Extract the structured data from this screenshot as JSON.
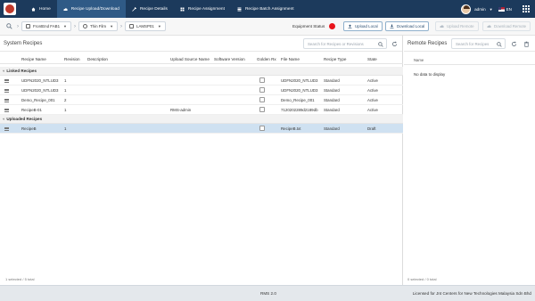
{
  "topbar": {
    "tabs": [
      {
        "label": "Home",
        "icon": "home-icon"
      },
      {
        "label": "Recipe Upload/Download",
        "icon": "cloud-icon"
      },
      {
        "label": "Recipe Details",
        "icon": "tools-icon"
      },
      {
        "label": "Recipe Assignment",
        "icon": "assign-icon"
      },
      {
        "label": "Recipe Batch Assignment",
        "icon": "batch-icon"
      }
    ],
    "active_tab": "Recipe Upload/Download",
    "user": "admin",
    "language": "EN"
  },
  "toolbar": {
    "breadcrumbs": [
      {
        "label": "FrontEnd FAB1"
      },
      {
        "label": "Thin Film"
      },
      {
        "label": "LAMSP01"
      }
    ],
    "equipment_status_label": "Equipment Status",
    "equipment_status_color": "#e8141b",
    "buttons": {
      "upload_local": "Upload Local",
      "download_local": "Download Local",
      "upload_remote": "Upload Remote",
      "download_remote": "Download Remote"
    }
  },
  "system_recipes": {
    "title": "System Recipes",
    "search_placeholder": "Search for Recipes or Revisions",
    "columns": {
      "recipe_name": "Recipe Name",
      "revision": "Revision",
      "description": "Description",
      "upload_source": "Upload Source Name",
      "software_version": "Software Version",
      "golden_rx": "Golden Rx",
      "file_name": "File Name",
      "recipe_type": "Recipe Type",
      "state": "State"
    },
    "groups": [
      {
        "label": "Linked Recipes",
        "rows": [
          {
            "name": "UDFN2020_NTLUD3",
            "revision": "1",
            "description": "",
            "upload_source": "",
            "software_version": "",
            "file": "UDFN2020_NTLUD3",
            "type": "Standard",
            "state": "Active"
          },
          {
            "name": "UDFN2020_NTLUD3",
            "revision": "1",
            "description": "",
            "upload_source": "",
            "software_version": "",
            "file": "UDFN2020_NTLUD3",
            "type": "Standard",
            "state": "Active"
          },
          {
            "name": "Demo_Recipe_001",
            "revision": "2",
            "description": "",
            "upload_source": "",
            "software_version": "",
            "file": "Demo_Recipe_001",
            "type": "Standard",
            "state": "Active"
          },
          {
            "name": "RecipeB-01",
            "revision": "1",
            "description": "",
            "upload_source": "RMS-admin",
            "software_version": "",
            "file": "7120202289d2189db",
            "type": "Standard",
            "state": "Active"
          }
        ]
      },
      {
        "label": "Uploaded Recipes",
        "rows": [
          {
            "name": "RecipeB",
            "revision": "1",
            "description": "",
            "upload_source": "",
            "software_version": "",
            "file": "RecipeB.txt",
            "type": "Standard",
            "state": "Draft"
          }
        ]
      }
    ],
    "status": "1 selected / 5 total"
  },
  "remote_recipes": {
    "title": "Remote Recipes",
    "search_placeholder": "Search for Recipes",
    "column_name": "Name",
    "empty_text": "No data to display",
    "status": "0 selected / 0 total"
  },
  "footer": {
    "version": "RMS 2.0",
    "license": "Licensed for Jnt Centers for New Technologies Malaysia Sdn Bhd"
  }
}
